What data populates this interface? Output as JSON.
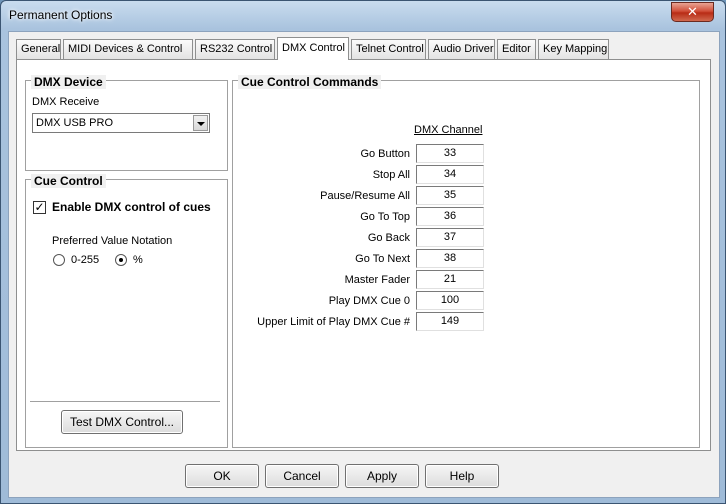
{
  "window": {
    "title": "Permanent Options",
    "close_glyph": "✕"
  },
  "tabs": [
    {
      "label": "General",
      "active": false
    },
    {
      "label": "MIDI Devices & Control",
      "active": false
    },
    {
      "label": "RS232 Control",
      "active": false
    },
    {
      "label": "DMX Control",
      "active": true
    },
    {
      "label": "Telnet Control",
      "active": false
    },
    {
      "label": "Audio Driver",
      "active": false
    },
    {
      "label": "Editor",
      "active": false
    },
    {
      "label": "Key Mapping",
      "active": false
    }
  ],
  "dmx_device": {
    "title": "DMX Device",
    "receive_label": "DMX Receive",
    "receive_value": "DMX USB PRO"
  },
  "cue_control": {
    "title": "Cue Control",
    "enable_label": "Enable DMX control of cues",
    "enable_checked": true,
    "check_glyph": "✓",
    "notation_label": "Preferred Value Notation",
    "option_range": "0-255",
    "option_percent": "%",
    "selected": "%",
    "test_button": "Test DMX Control..."
  },
  "commands": {
    "title": "Cue Control Commands",
    "column_header": "DMX Channel",
    "rows": [
      {
        "label": "Go Button",
        "value": "33"
      },
      {
        "label": "Stop All",
        "value": "34"
      },
      {
        "label": "Pause/Resume All",
        "value": "35"
      },
      {
        "label": "Go To Top",
        "value": "36"
      },
      {
        "label": "Go Back",
        "value": "37"
      },
      {
        "label": "Go To Next",
        "value": "38"
      },
      {
        "label": "Master Fader",
        "value": "21"
      },
      {
        "label": "Play DMX Cue 0",
        "value": "100"
      },
      {
        "label": "Upper Limit of Play DMX Cue #",
        "value": "149"
      }
    ]
  },
  "footer": {
    "ok": "OK",
    "cancel": "Cancel",
    "apply": "Apply",
    "help": "Help"
  }
}
